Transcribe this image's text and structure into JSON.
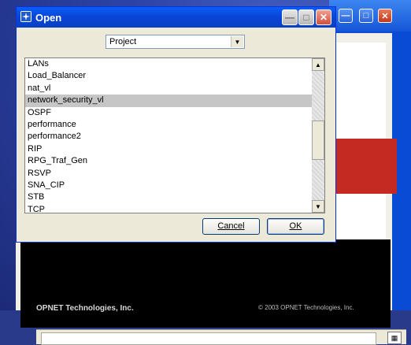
{
  "dialog": {
    "title": "Open",
    "minimize_glyph": "—",
    "maximize_glyph": "□",
    "close_glyph": "✕"
  },
  "selector": {
    "value": "Project",
    "arrow": "▼"
  },
  "list": {
    "items": [
      {
        "label": "LANs",
        "selected": false
      },
      {
        "label": "Load_Balancer",
        "selected": false
      },
      {
        "label": "nat_vl",
        "selected": false
      },
      {
        "label": "network_security_vl",
        "selected": true
      },
      {
        "label": "OSPF",
        "selected": false
      },
      {
        "label": "performance",
        "selected": false
      },
      {
        "label": "performance2",
        "selected": false
      },
      {
        "label": "RIP",
        "selected": false
      },
      {
        "label": "RPG_Traf_Gen",
        "selected": false
      },
      {
        "label": "RSVP",
        "selected": false
      },
      {
        "label": "SNA_CIP",
        "selected": false
      },
      {
        "label": "STB",
        "selected": false
      },
      {
        "label": "TCP",
        "selected": false
      }
    ],
    "scroll_up": "▲",
    "scroll_down": "▼",
    "scroll_position": 0.55
  },
  "buttons": {
    "cancel": "Cancel",
    "ok": "OK"
  },
  "splash": {
    "company": "OPNET Technologies, Inc.",
    "copyright": "© 2003 OPNET Technologies, Inc."
  },
  "colors": {
    "titlebar": "#0a46d6",
    "selection": "#c6c6c6",
    "desktop": "#2d44a8"
  }
}
